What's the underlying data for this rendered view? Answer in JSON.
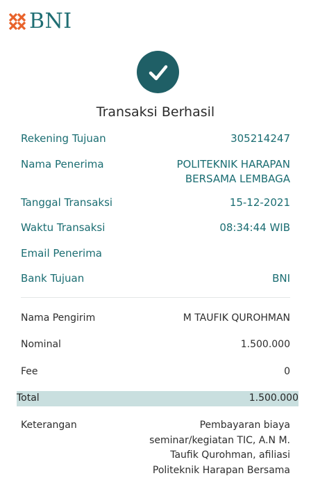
{
  "brand": {
    "name": "BNI"
  },
  "title": "Transaksi Berhasil",
  "details": {
    "rekening_tujuan": {
      "label": "Rekening Tujuan",
      "value": "305214247"
    },
    "nama_penerima": {
      "label": "Nama Penerima",
      "value": "POLITEKNIK HARAPAN BERSAMA LEMBAGA"
    },
    "tanggal_transaksi": {
      "label": "Tanggal Transaksi",
      "value": "15-12-2021"
    },
    "waktu_transaksi": {
      "label": "Waktu Transaksi",
      "value": "08:34:44 WIB"
    },
    "email_penerima": {
      "label": "Email Penerima",
      "value": ""
    },
    "bank_tujuan": {
      "label": "Bank Tujuan",
      "value": "BNI"
    }
  },
  "summary": {
    "nama_pengirim": {
      "label": "Nama Pengirim",
      "value": "M TAUFIK QUROHMAN"
    },
    "nominal": {
      "label": "Nominal",
      "value": "1.500.000"
    },
    "fee": {
      "label": "Fee",
      "value": "0"
    },
    "total": {
      "label": "Total",
      "value": "1.500.000"
    },
    "keterangan": {
      "label": "Keterangan",
      "value": "Pembayaran biaya seminar/kegiatan TIC, A.N M. Taufik Qurohman, afiliasi Politeknik Harapan Bersama"
    }
  },
  "colors": {
    "accent": "#1a6d72",
    "check_bg": "#1f5f66",
    "total_bar": "#c9dfdf",
    "logo_orange": "#e8622a"
  }
}
